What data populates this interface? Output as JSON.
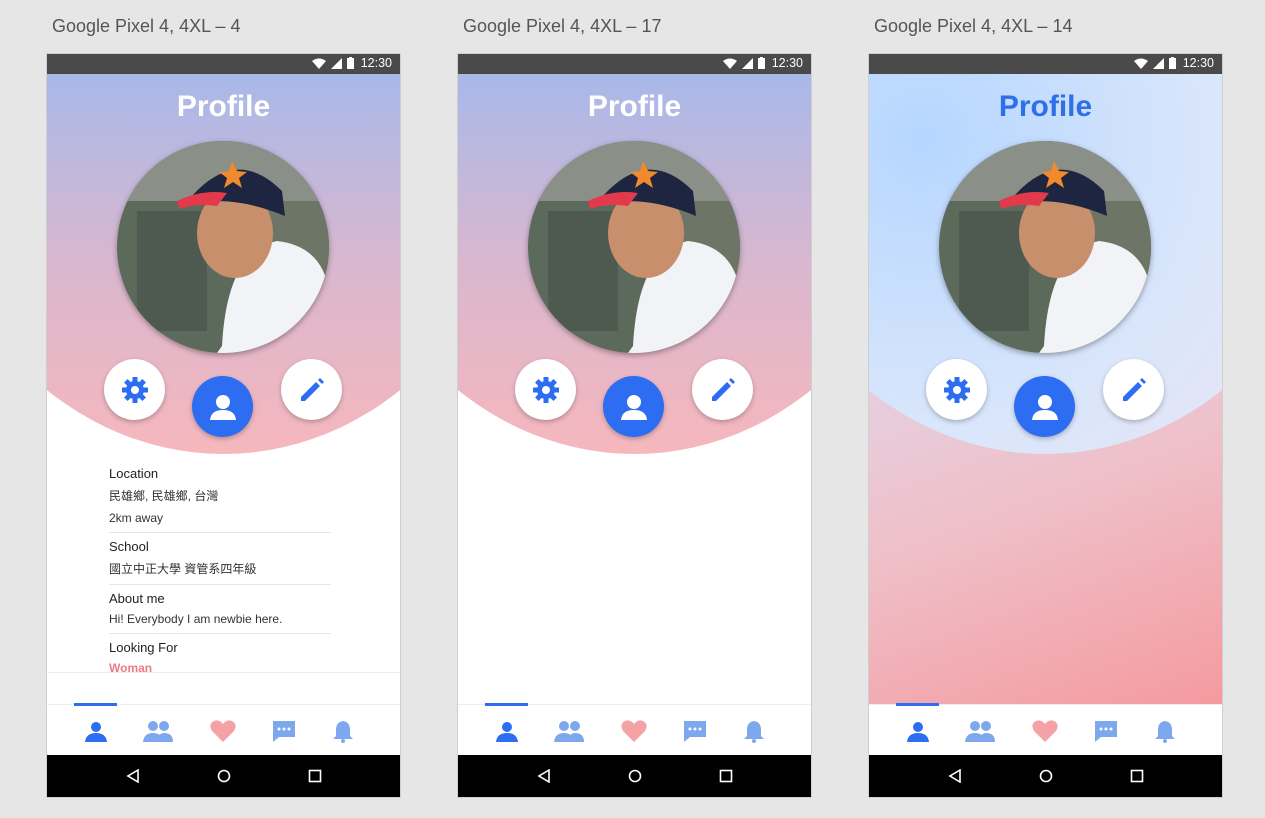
{
  "artboards": [
    {
      "title": "Google Pixel 4, 4XL – 4"
    },
    {
      "title": "Google Pixel 4, 4XL – 17"
    },
    {
      "title": "Google Pixel 4, 4XL – 14"
    }
  ],
  "status_bar": {
    "time": "12:30"
  },
  "header": {
    "title": "Profile"
  },
  "info": {
    "location_label": "Location",
    "location_value": "民雄鄉, 民雄鄉, 台灣",
    "distance": "2km away",
    "school_label": "School",
    "school_value": "國立中正大學 資管系四年級",
    "about_label": "About me",
    "about_value": "Hi! Everybody I am newbie here.",
    "looking_label": "Looking For",
    "looking_value": "Woman"
  },
  "nav": [
    "person-icon",
    "group-icon",
    "heart-icon",
    "chat-icon",
    "bell-icon"
  ],
  "colors": {
    "accent": "#2d6df1",
    "nav_light": "#7ea8ee",
    "heart": "#f4a2a6",
    "looking": "#ec7c84"
  }
}
